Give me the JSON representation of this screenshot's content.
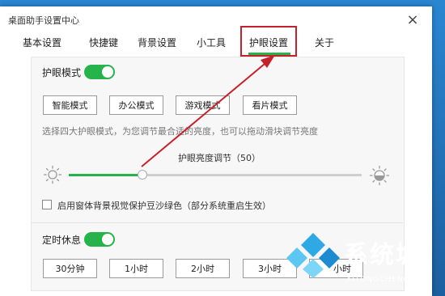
{
  "window": {
    "title": "桌面助手设置中心",
    "close_glyph": "×"
  },
  "tabs": [
    {
      "label": "基本设置"
    },
    {
      "label": "快捷键"
    },
    {
      "label": "背景设置"
    },
    {
      "label": "小工具"
    },
    {
      "label": "护眼设置",
      "active": true
    },
    {
      "label": "关于"
    }
  ],
  "eye_protection": {
    "label": "护眼模式",
    "enabled": true,
    "modes": [
      "智能模式",
      "办公模式",
      "游戏模式",
      "看片模式"
    ],
    "description": "选择四大护眼模式，为您调节最合适的亮度，也可以拖动滑块调节亮度",
    "brightness_label": "护眼亮度调节（50）",
    "brightness_value": 50,
    "background_option": "启用窗体背景视觉保护豆沙绿色（部分系统重启生效）",
    "background_checked": false
  },
  "rest_timer": {
    "label": "定时休息",
    "enabled": true,
    "options": [
      "30分钟",
      "1小时",
      "2小时",
      "3小时",
      "小时"
    ]
  },
  "watermark": {
    "text": "系统城",
    "url": "XITONGCHENG.COM"
  },
  "colors": {
    "accent": "#27b34b",
    "highlight": "#c8202a"
  }
}
